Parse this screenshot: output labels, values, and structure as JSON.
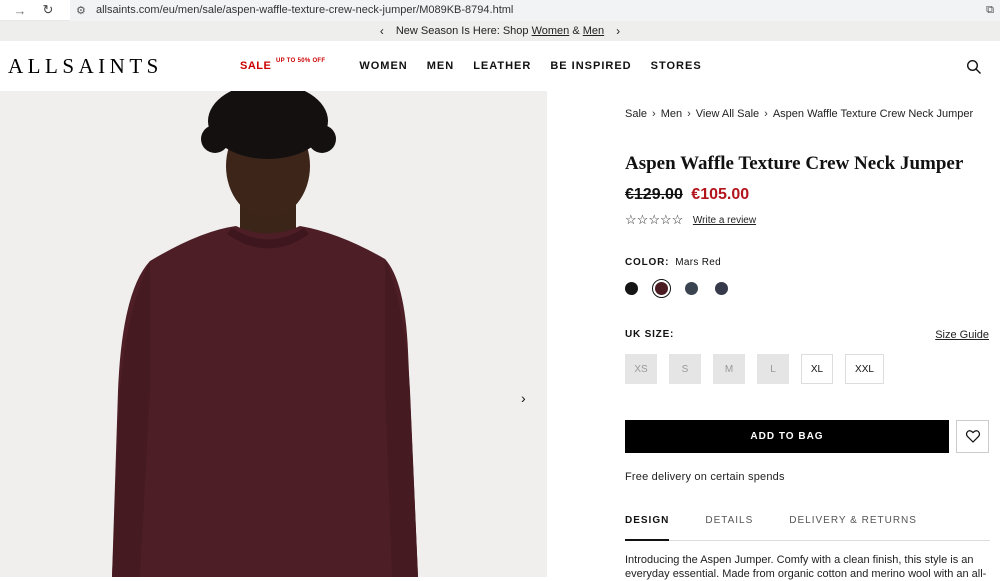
{
  "browser": {
    "url": "allsaints.com/eu/men/sale/aspen-waffle-texture-crew-neck-jumper/M089KB-8794.html"
  },
  "announcement": {
    "text": "New Season Is Here: Shop ",
    "link_women": "Women",
    "amp": " & ",
    "link_men": "Men"
  },
  "header": {
    "logo": "ALLSAINTS",
    "sale_label": "SALE",
    "sale_badge": "UP TO 50% OFF",
    "nav": [
      "WOMEN",
      "MEN",
      "LEATHER",
      "BE INSPIRED",
      "STORES"
    ]
  },
  "breadcrumb": [
    "Sale",
    "Men",
    "View All Sale",
    "Aspen Waffle Texture Crew Neck Jumper"
  ],
  "product": {
    "title": "Aspen Waffle Texture Crew Neck Jumper",
    "price_old": "€129.00",
    "price_new": "€105.00",
    "rating_stars": 0,
    "review_link": "Write a review",
    "color_label": "COLOR:",
    "color_value": "Mars Red",
    "swatches": [
      {
        "name": "Black",
        "color": "#151515"
      },
      {
        "name": "Mars Red",
        "color": "#4a1c22"
      },
      {
        "name": "Slate",
        "color": "#3a4450"
      },
      {
        "name": "Navy",
        "color": "#363a4a"
      }
    ],
    "size_label": "UK SIZE:",
    "size_guide": "Size Guide",
    "sizes": [
      {
        "label": "XS",
        "available": false
      },
      {
        "label": "S",
        "available": false
      },
      {
        "label": "M",
        "available": false
      },
      {
        "label": "L",
        "available": false
      },
      {
        "label": "XL",
        "available": true
      },
      {
        "label": "XXL",
        "available": true
      }
    ],
    "add_to_bag": "ADD TO BAG",
    "delivery": "Free delivery on certain spends",
    "tabs": [
      "DESIGN",
      "DETAILS",
      "DELIVERY & RETURNS"
    ],
    "description": "Introducing the Aspen Jumper. Comfy with a clean finish, this style is an everyday essential. Made from organic cotton and merino wool with an all-"
  },
  "colors": {
    "sale_red": "#b3151d",
    "jumper": "#4e1e26"
  }
}
